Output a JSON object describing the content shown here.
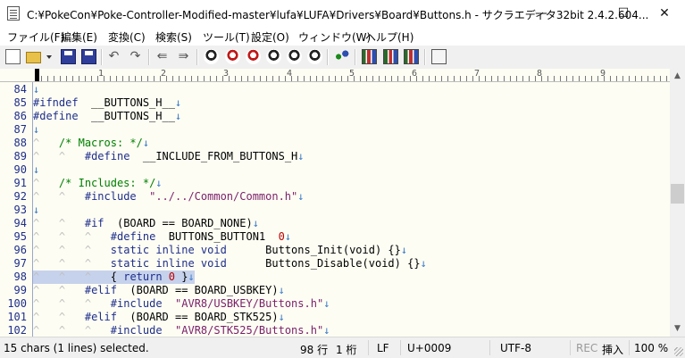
{
  "window": {
    "title": "C:¥PokeCon¥Poke-Controller-Modified-master¥lufa¥LUFA¥Drivers¥Board¥Buttons.h - サクラエディタ32bit 2.4.2.604...",
    "minimize": "—",
    "maximize": "☐",
    "close": "✕"
  },
  "menu": [
    "ファイル(F)",
    "編集(E)",
    "変換(C)",
    "検索(S)",
    "ツール(T)",
    "設定(O)",
    "ウィンドウ(W)",
    "ヘルプ(H)"
  ],
  "toolbar": {
    "undo": "↶",
    "redo": "↷",
    "jump_back": "⇚",
    "jump_fwd": "⇛"
  },
  "ruler": {
    "labels": [
      "1",
      "2",
      "3",
      "4",
      "5",
      "6",
      "7",
      "8",
      "9"
    ]
  },
  "editor": {
    "line_numbers": [
      "84",
      "85",
      "86",
      "87",
      "88",
      "89",
      "90",
      "91",
      "92",
      "93",
      "94",
      "95",
      "96",
      "97",
      "98",
      "99",
      "100",
      "101",
      "102"
    ],
    "lines": [
      [
        [
          "eol",
          "↓"
        ]
      ],
      [
        [
          "kw",
          "#ifndef"
        ],
        [
          "",
          "  __BUTTONS_H__"
        ],
        [
          "eol",
          "↓"
        ]
      ],
      [
        [
          "kw",
          "#define"
        ],
        [
          "",
          "  __BUTTONS_H__"
        ],
        [
          "eol",
          "↓"
        ]
      ],
      [
        [
          "eol",
          "↓"
        ]
      ],
      [
        [
          "ctl",
          "^"
        ],
        [
          "",
          "   "
        ],
        [
          "cm",
          "/* Macros: */"
        ],
        [
          "eol",
          "↓"
        ]
      ],
      [
        [
          "ctl",
          "^"
        ],
        [
          "",
          "   "
        ],
        [
          "ctl",
          "^"
        ],
        [
          "",
          "   "
        ],
        [
          "kw",
          "#define"
        ],
        [
          "",
          "  __INCLUDE_FROM_BUTTONS_H"
        ],
        [
          "eol",
          "↓"
        ]
      ],
      [
        [
          "eol",
          "↓"
        ]
      ],
      [
        [
          "ctl",
          "^"
        ],
        [
          "",
          "   "
        ],
        [
          "cm",
          "/* Includes: */"
        ],
        [
          "eol",
          "↓"
        ]
      ],
      [
        [
          "ctl",
          "^"
        ],
        [
          "",
          "   "
        ],
        [
          "ctl",
          "^"
        ],
        [
          "",
          "   "
        ],
        [
          "kw",
          "#include"
        ],
        [
          "",
          "  "
        ],
        [
          "st",
          "\"../../Common/Common.h\""
        ],
        [
          "eol",
          "↓"
        ]
      ],
      [
        [
          "eol",
          "↓"
        ]
      ],
      [
        [
          "ctl",
          "^"
        ],
        [
          "",
          "   "
        ],
        [
          "ctl",
          "^"
        ],
        [
          "",
          "   "
        ],
        [
          "kw",
          "#if"
        ],
        [
          "",
          "  (BOARD == BOARD_NONE)"
        ],
        [
          "eol",
          "↓"
        ]
      ],
      [
        [
          "ctl",
          "^"
        ],
        [
          "",
          "   "
        ],
        [
          "ctl",
          "^"
        ],
        [
          "",
          "   "
        ],
        [
          "ctl",
          "^"
        ],
        [
          "",
          "   "
        ],
        [
          "kw",
          "#define"
        ],
        [
          "",
          "  BUTTONS_BUTTON1  "
        ],
        [
          "nm",
          "0"
        ],
        [
          "eol",
          "↓"
        ]
      ],
      [
        [
          "ctl",
          "^"
        ],
        [
          "",
          "   "
        ],
        [
          "ctl",
          "^"
        ],
        [
          "",
          "   "
        ],
        [
          "ctl",
          "^"
        ],
        [
          "",
          "   "
        ],
        [
          "kw",
          "static inline void"
        ],
        [
          "",
          "      Buttons_Init(void) {}"
        ],
        [
          "eol",
          "↓"
        ]
      ],
      [
        [
          "ctl",
          "^"
        ],
        [
          "",
          "   "
        ],
        [
          "ctl",
          "^"
        ],
        [
          "",
          "   "
        ],
        [
          "ctl",
          "^"
        ],
        [
          "",
          "   "
        ],
        [
          "kw",
          "static inline void"
        ],
        [
          "",
          "      Buttons_Disable(void) {}"
        ],
        [
          "eol",
          "↓"
        ]
      ],
      [
        [
          "ctl",
          "^"
        ],
        [
          "",
          "   "
        ],
        [
          "ctl",
          "^"
        ],
        [
          "",
          "   "
        ],
        [
          "ctl",
          "^"
        ],
        [
          "",
          "   "
        ],
        [
          "",
          "{ "
        ],
        [
          "kw",
          "return"
        ],
        [
          "",
          ""
        ],
        [
          "nm",
          " 0"
        ],
        [
          "",
          " }"
        ],
        [
          "eol",
          "↓"
        ]
      ],
      [
        [
          "ctl",
          "^"
        ],
        [
          "",
          "   "
        ],
        [
          "ctl",
          "^"
        ],
        [
          "",
          "   "
        ],
        [
          "kw",
          "#elif"
        ],
        [
          "",
          "  (BOARD == BOARD_USBKEY)"
        ],
        [
          "eol",
          "↓"
        ]
      ],
      [
        [
          "ctl",
          "^"
        ],
        [
          "",
          "   "
        ],
        [
          "ctl",
          "^"
        ],
        [
          "",
          "   "
        ],
        [
          "ctl",
          "^"
        ],
        [
          "",
          "   "
        ],
        [
          "kw",
          "#include"
        ],
        [
          "",
          "  "
        ],
        [
          "st",
          "\"AVR8/USBKEY/Buttons.h\""
        ],
        [
          "eol",
          "↓"
        ]
      ],
      [
        [
          "ctl",
          "^"
        ],
        [
          "",
          "   "
        ],
        [
          "ctl",
          "^"
        ],
        [
          "",
          "   "
        ],
        [
          "kw",
          "#elif"
        ],
        [
          "",
          "  (BOARD == BOARD_STK525)"
        ],
        [
          "eol",
          "↓"
        ]
      ],
      [
        [
          "ctl",
          "^"
        ],
        [
          "",
          "   "
        ],
        [
          "ctl",
          "^"
        ],
        [
          "",
          "   "
        ],
        [
          "ctl",
          "^"
        ],
        [
          "",
          "   "
        ],
        [
          "kw",
          "#include"
        ],
        [
          "",
          "  "
        ],
        [
          "st",
          "\"AVR8/STK525/Buttons.h\""
        ],
        [
          "eol",
          "↓"
        ]
      ]
    ]
  },
  "status": {
    "selection": "15 chars (1 lines) selected.",
    "row": "98 行",
    "col": "1 桁",
    "eol": "LF",
    "codepoint": "U+0009",
    "encoding": "UTF-8",
    "rec": "REC",
    "insert": "挿入",
    "zoom": "100 %"
  },
  "colors": {
    "keyword": "#1e2e8c",
    "comment": "#008000",
    "string": "#7a1f6a",
    "number": "#c00000",
    "selection": "#c6d2ec",
    "background": "#fdfdf3"
  }
}
